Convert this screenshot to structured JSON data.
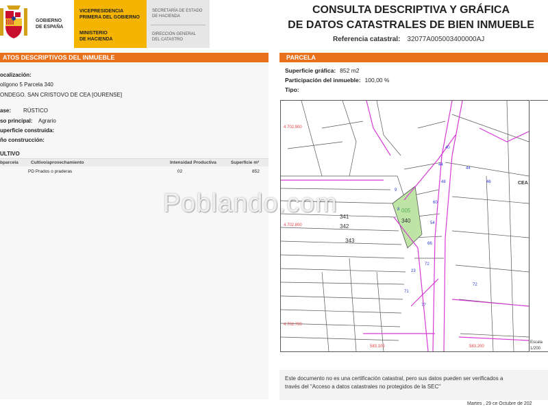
{
  "header": {
    "logo_text": [
      "GOBIERNO",
      "DE ESPAÑA"
    ],
    "gold_line1": [
      "VICEPRESIDENCIA",
      "PRIMERA DEL GOBIERNO"
    ],
    "gold_line2": [
      "MINISTERIO",
      "DE HACIENDA"
    ],
    "gray_line1": [
      "SECRETARÍA DE ESTADO",
      "DE HACIENDA"
    ],
    "gray_line2": [
      "DIRECCIÓN GENERAL",
      "DEL CATASTRO"
    ],
    "title_line1": "CONSULTA DESCRIPTIVA Y GRÁFICA",
    "title_line2": "DE DATOS CATASTRALES DE BIEN INMUEBLE",
    "ref_label": "Referencia catastral:",
    "ref_value": "32077A005003400000AJ"
  },
  "left": {
    "section_title": "ATOS DESCRIPTIVOS DEL INMUEBLE",
    "localizacion_label": "ocalización:",
    "localizacion_line1": "olígono 5 Parcela 340",
    "localizacion_line2": "ONDEGO. SAN CRISTOVO DE CEA [OURENSE]",
    "clase_label": "ase:",
    "clase_value": "RÚSTICO",
    "uso_label": "so principal:",
    "uso_value": "Agrario",
    "superficie_label": "uperficie construida:",
    "anio_label": "ño construcción:",
    "cultivo_title": "ULTIVO",
    "cult_headers": [
      "bparcela",
      "Cultivo/aprovechamiento",
      "Intensidad Productiva",
      "Superficie m²"
    ],
    "cult_row": [
      "",
      "PD Prados o praderas",
      "02",
      "852"
    ]
  },
  "right": {
    "section_title": "PARCELA",
    "sup_label": "Superficie gráfica:",
    "sup_value": "852 m2",
    "part_label": "Participación del inmueble:",
    "part_value": "100,00 %",
    "tipo_label": "Tipo:",
    "map_labels": {
      "n1": "4.702.900",
      "n2": "4.702.800",
      "n3": "4.702.700",
      "e1": "583.100",
      "e2": "583.200",
      "p005": "005",
      "p340": "340",
      "p341": "341",
      "p342": "342",
      "p343": "343",
      "cea": "CEA"
    },
    "scale_label": "Escala",
    "scale_value": "1/200"
  },
  "footer": {
    "disclaimer_line1": "Este documento no es una certificación catastral, pero sus datos pueden ser verificados a",
    "disclaimer_line2": "través del \"Acceso a datos catastrales no protegidos de la SEC\"",
    "date": "Martes , 29 ce Octubre de 202"
  },
  "watermark": "Poblando.com",
  "colors": {
    "orange": "#e8711c",
    "gold": "#f4b400",
    "parcel_fill": "#bfe5a6",
    "boundary_magenta": "#d63ad6",
    "node_blue": "#2a3bd6"
  }
}
